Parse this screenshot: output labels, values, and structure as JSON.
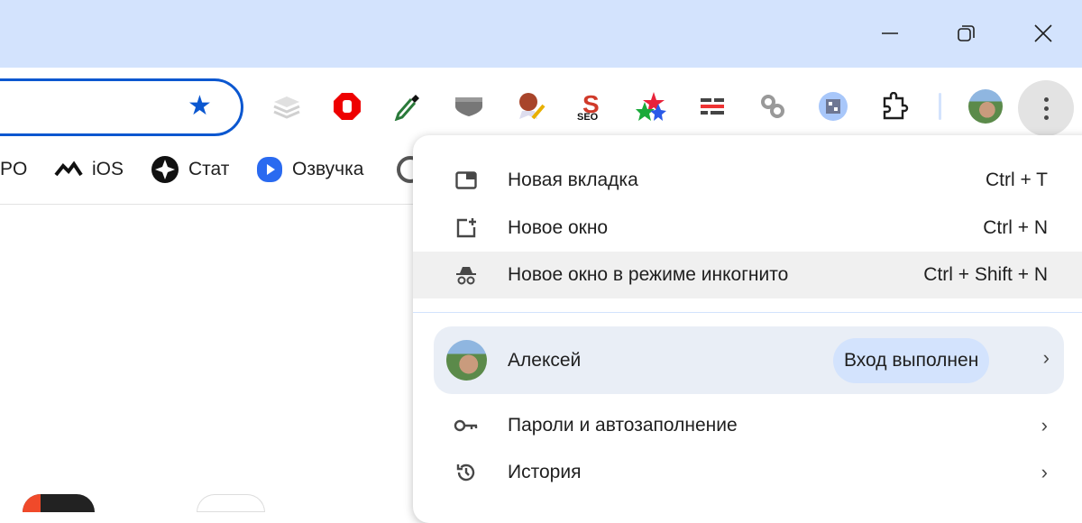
{
  "window_controls": {
    "minimize": "minimize-icon",
    "restore": "restore-icon",
    "close": "close-icon"
  },
  "toolbar": {
    "extensions": [
      "layers",
      "adblock",
      "eyedropper",
      "shield",
      "seal-pencil",
      "seo",
      "stars",
      "lines",
      "link",
      "qr",
      "puzzle"
    ],
    "seo_label": "SEO"
  },
  "bookmarks": [
    {
      "label": "PO"
    },
    {
      "label": "iOS"
    },
    {
      "label": "Стат"
    },
    {
      "label": "Озвучка"
    }
  ],
  "menu": {
    "items": [
      {
        "label": "Новая вкладка",
        "shortcut": "Ctrl + T"
      },
      {
        "label": "Новое окно",
        "shortcut": "Ctrl + N"
      },
      {
        "label": "Новое окно в режиме инкогнито",
        "shortcut": "Ctrl + Shift + N"
      }
    ],
    "profile": {
      "name": "Алексей",
      "status": "Вход выполнен"
    },
    "sub_items": [
      {
        "label": "Пароли и автозаполнение"
      },
      {
        "label": "История"
      }
    ]
  },
  "colors": {
    "accent": "#0b57d0",
    "titlebar": "#d3e3fd"
  }
}
